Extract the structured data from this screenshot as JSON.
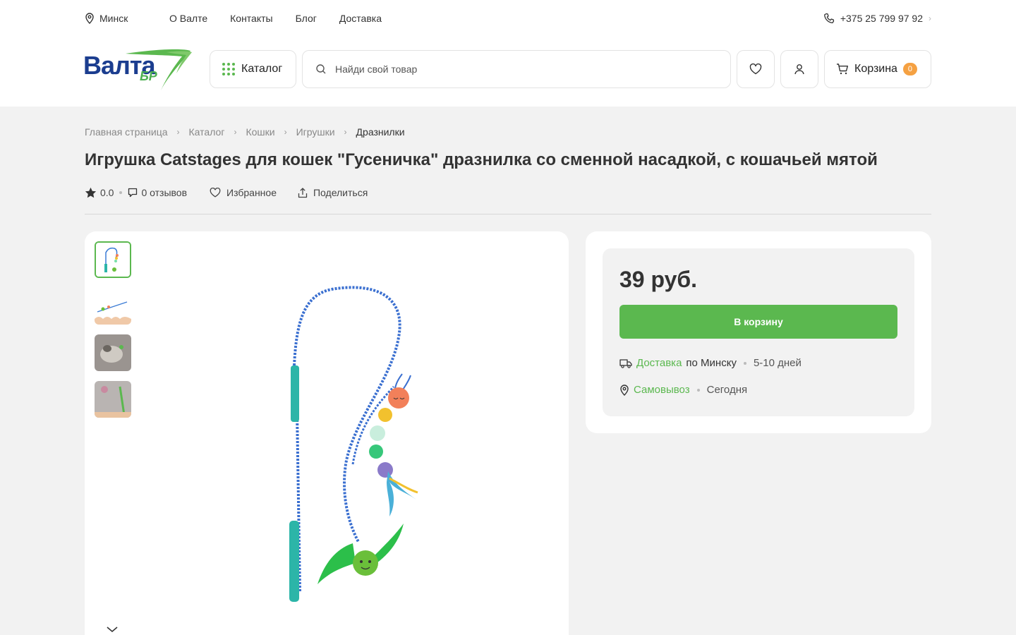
{
  "topbar": {
    "city": "Минск",
    "nav": [
      "О Валте",
      "Контакты",
      "Блог",
      "Доставка"
    ],
    "phone": "+375 25 799 97 92"
  },
  "header": {
    "logo_text": "Валта",
    "logo_sub": "БР",
    "catalog_label": "Каталог",
    "search_placeholder": "Найди свой товар",
    "cart_label": "Корзина",
    "cart_count": "0"
  },
  "breadcrumb": [
    "Главная страница",
    "Каталог",
    "Кошки",
    "Игрушки",
    "Дразнилки"
  ],
  "product": {
    "title": "Игрушка Catstages для кошек \"Гусеничка\" дразнилка со сменной насадкой, с кошачьей мятой",
    "rating": "0.0",
    "reviews": "0 отзывов",
    "favorite": "Избранное",
    "share": "Поделиться"
  },
  "buy": {
    "price": "39 руб.",
    "add_to_cart": "В корзину",
    "delivery_link": "Доставка",
    "delivery_text": "по Минску",
    "delivery_time": "5-10 дней",
    "pickup_link": "Самовывоз",
    "pickup_time": "Сегодня"
  },
  "colors": {
    "accent": "#5bb84f",
    "brand_blue": "#1b3d8f",
    "badge": "#f5a142"
  }
}
